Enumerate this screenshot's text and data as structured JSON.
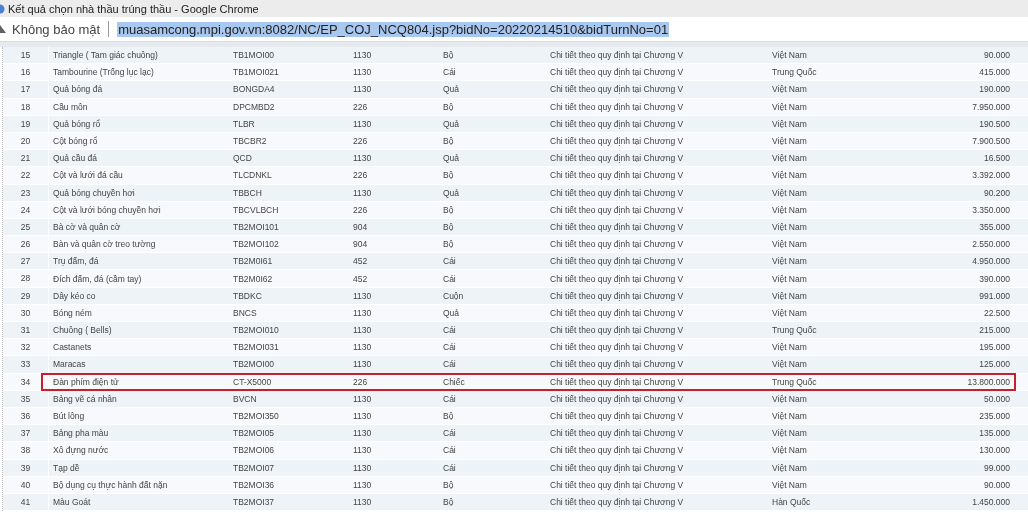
{
  "window": {
    "title": "Kết quả chọn nhà thầu trúng thầu - Google Chrome"
  },
  "address_bar": {
    "security_label": "Không bảo mật",
    "url": "muasamcong.mpi.gov.vn:8082/NC/EP_COJ_NCQ804.jsp?bidNo=20220214510&bidTurnNo=01",
    "url_selected": true
  },
  "table": {
    "rows": [
      {
        "cells": [
          "15",
          "Triangle ( Tam giác chuông)",
          "TB1MOI00",
          "1130",
          "Bộ",
          "Chi tiết theo quy định tại Chương V",
          "Việt Nam",
          "90.000"
        ],
        "highlighted": false
      },
      {
        "cells": [
          "16",
          "Tambourine (Trống lục lạc)",
          "TB1MOI021",
          "1130",
          "Cái",
          "Chi tiết theo quy định tại Chương V",
          "Trung Quốc",
          "415.000"
        ],
        "highlighted": false
      },
      {
        "cells": [
          "17",
          "Quả bóng đá",
          "BONGDA4",
          "1130",
          "Quả",
          "Chi tiết theo quy định tại Chương V",
          "Việt Nam",
          "190.000"
        ],
        "highlighted": false
      },
      {
        "cells": [
          "18",
          "Cầu môn",
          "DPCMBD2",
          "226",
          "Bộ",
          "Chi tiết theo quy định tại Chương V",
          "Việt Nam",
          "7.950.000"
        ],
        "highlighted": false
      },
      {
        "cells": [
          "19",
          "Quả bóng rổ",
          "TLBR",
          "1130",
          "Quả",
          "Chi tiết theo quy định tại Chương V",
          "Việt Nam",
          "190.500"
        ],
        "highlighted": false
      },
      {
        "cells": [
          "20",
          "Cột bóng rổ",
          "TBCBR2",
          "226",
          "Bộ",
          "Chi tiết theo quy định tại Chương V",
          "Việt Nam",
          "7.900.500"
        ],
        "highlighted": false
      },
      {
        "cells": [
          "21",
          "Quả cầu đá",
          "QCD",
          "1130",
          "Quả",
          "Chi tiết theo quy định tại Chương V",
          "Việt Nam",
          "16.500"
        ],
        "highlighted": false
      },
      {
        "cells": [
          "22",
          "Cột và lưới đá cầu",
          "TLCDNKL",
          "226",
          "Bộ",
          "Chi tiết theo quy định tại Chương V",
          "Việt Nam",
          "3.392.000"
        ],
        "highlighted": false
      },
      {
        "cells": [
          "23",
          "Quả bóng chuyền hơi",
          "TBBCH",
          "1130",
          "Quả",
          "Chi tiết theo quy định tại Chương V",
          "Việt Nam",
          "90.200"
        ],
        "highlighted": false
      },
      {
        "cells": [
          "24",
          "Cột và lưới bóng chuyền hơi",
          "TBCVLBCH",
          "226",
          "Bộ",
          "Chi tiết theo quy định tại Chương V",
          "Việt Nam",
          "3.350.000"
        ],
        "highlighted": false
      },
      {
        "cells": [
          "25",
          "Bà cờ và quân cờ",
          "TB2MOI101",
          "904",
          "Bộ",
          "Chi tiết theo quy định tại Chương V",
          "Việt Nam",
          "355.000"
        ],
        "highlighted": false
      },
      {
        "cells": [
          "26",
          "Bàn và quân cờ treo tường",
          "TB2MOI102",
          "904",
          "Bộ",
          "Chi tiết theo quy định tại Chương V",
          "Việt Nam",
          "2.550.000"
        ],
        "highlighted": false
      },
      {
        "cells": [
          "27",
          "Trụ đấm, đá",
          "TB2M0I61",
          "452",
          "Cái",
          "Chi tiết theo quy định tại Chương V",
          "Việt Nam",
          "4.950.000"
        ],
        "highlighted": false
      },
      {
        "cells": [
          "28",
          "Đích đấm, đá (cầm tay)",
          "TB2M0I62",
          "452",
          "Cái",
          "Chi tiết theo quy định tại Chương V",
          "Việt Nam",
          "390.000"
        ],
        "highlighted": false
      },
      {
        "cells": [
          "29",
          "Dây kéo co",
          "TBDKC",
          "1130",
          "Cuộn",
          "Chi tiết theo quy định tại Chương V",
          "Việt Nam",
          "991.000"
        ],
        "highlighted": false
      },
      {
        "cells": [
          "30",
          "Bóng ném",
          "BNCS",
          "1130",
          "Quả",
          "Chi tiết theo quy định tại Chương V",
          "Việt Nam",
          "22.500"
        ],
        "highlighted": false
      },
      {
        "cells": [
          "31",
          "Chuông ( Bells)",
          "TB2MOI010",
          "1130",
          "Cái",
          "Chi tiết theo quy định tại Chương V",
          "Trung Quốc",
          "215.000"
        ],
        "highlighted": false
      },
      {
        "cells": [
          "32",
          "Castanets",
          "TB2MOI031",
          "1130",
          "Cái",
          "Chi tiết theo quy định tại Chương V",
          "Việt Nam",
          "195.000"
        ],
        "highlighted": false
      },
      {
        "cells": [
          "33",
          "Maracas",
          "TB2MOI00",
          "1130",
          "Cái",
          "Chi tiết theo quy định tại Chương V",
          "Việt Nam",
          "125.000"
        ],
        "highlighted": false
      },
      {
        "cells": [
          "34",
          "Đàn phím điện tử",
          "CT-X5000",
          "226",
          "Chiếc",
          "Chi tiết theo quy định tại Chương V",
          "Trung Quốc",
          "13.800.000"
        ],
        "highlighted": true
      },
      {
        "cells": [
          "35",
          "Bảng vẽ cá nhân",
          "BVCN",
          "1130",
          "Cái",
          "Chi tiết theo quy định tại Chương V",
          "Việt Nam",
          "50.000"
        ],
        "highlighted": false
      },
      {
        "cells": [
          "36",
          "Bút lông",
          "TB2MOI350",
          "1130",
          "Bộ",
          "Chi tiết theo quy định tại Chương V",
          "Việt Nam",
          "235.000"
        ],
        "highlighted": false
      },
      {
        "cells": [
          "37",
          "Bảng pha màu",
          "TB2MOI05",
          "1130",
          "Cái",
          "Chi tiết theo quy định tại Chương V",
          "Việt Nam",
          "135.000"
        ],
        "highlighted": false
      },
      {
        "cells": [
          "38",
          "Xô đựng nước",
          "TB2MOI06",
          "1130",
          "Cái",
          "Chi tiết theo quy định tại Chương V",
          "Việt Nam",
          "130.000"
        ],
        "highlighted": false
      },
      {
        "cells": [
          "39",
          "Tạp dề",
          "TB2MOI07",
          "1130",
          "Cái",
          "Chi tiết theo quy định tại Chương V",
          "Việt Nam",
          "99.000"
        ],
        "highlighted": false
      },
      {
        "cells": [
          "40",
          "Bộ dụng cụ thực hành đất nặn",
          "TB2MOI36",
          "1130",
          "Bộ",
          "Chi tiết theo quy định tại Chương V",
          "Việt Nam",
          "90.000"
        ],
        "highlighted": false
      },
      {
        "cells": [
          "41",
          "Màu Goát",
          "TB2MOI37",
          "1130",
          "Bộ",
          "Chi tiết theo quy định tại Chương V",
          "Hàn Quốc",
          "1.450.000"
        ],
        "highlighted": false
      }
    ]
  }
}
